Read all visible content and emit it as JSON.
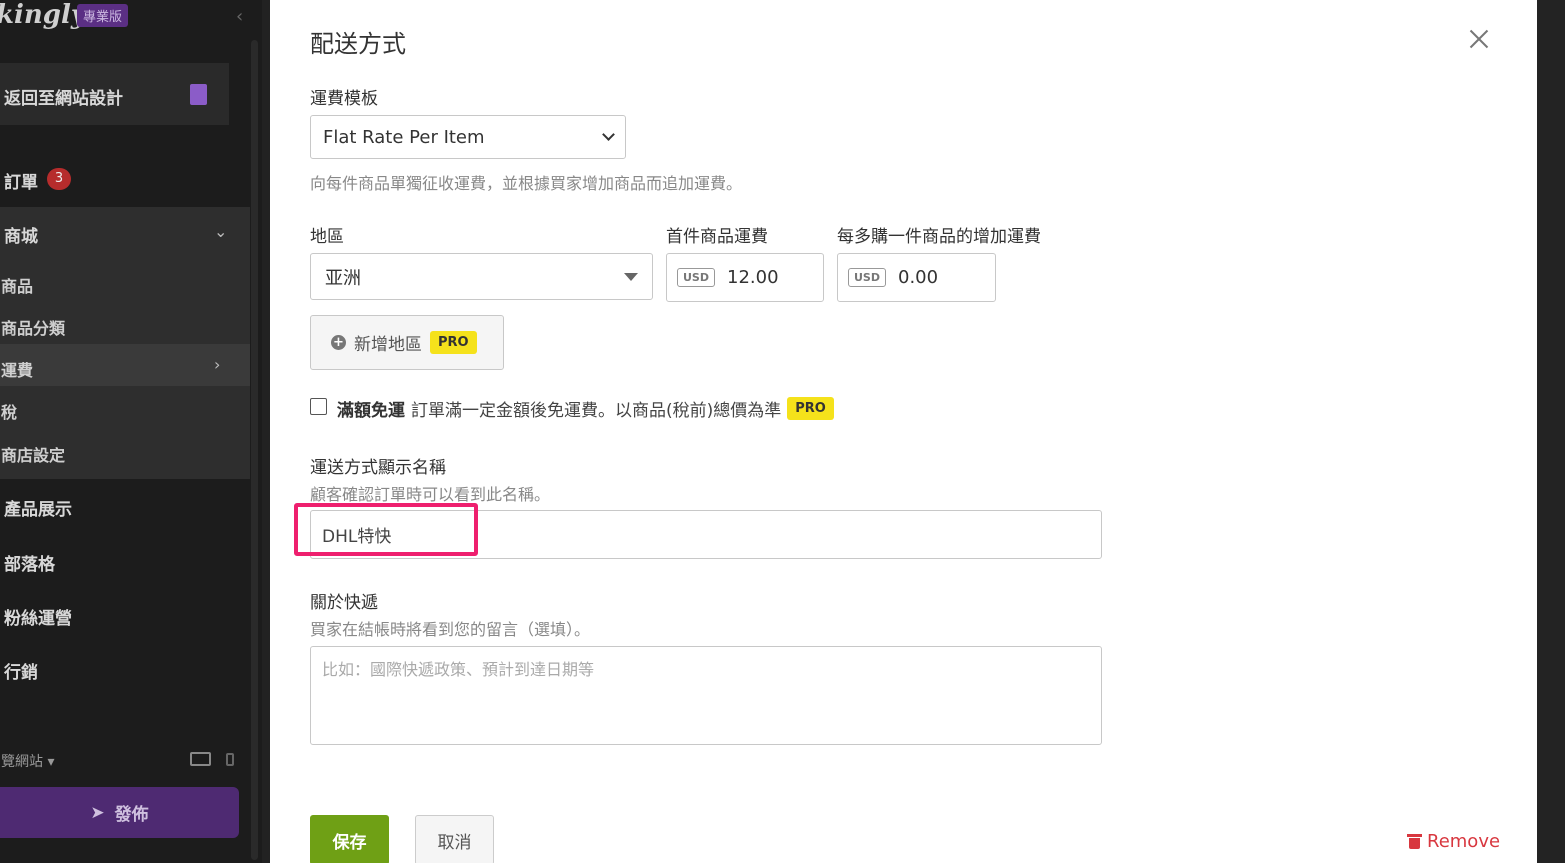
{
  "sidebar": {
    "logo": "kingly",
    "plan_badge": "專業版",
    "back_label": "返回至網站設計",
    "orders_label": "訂單",
    "orders_count": "3",
    "shop_label": "商城",
    "shop_items": [
      "商品",
      "商品分類",
      "運費",
      "稅",
      "商店設定"
    ],
    "products_label": "產品展示",
    "blog_label": "部落格",
    "fans_label": "粉絲運營",
    "marketing_label": "行銷",
    "preview_label": "覽網站",
    "publish_label": "發佈"
  },
  "modal": {
    "title": "配送方式",
    "template_label": "運費模板",
    "template_value": "Flat Rate Per Item",
    "template_help": "向每件商品單獨征收運費，並根據買家增加商品而追加運費。",
    "region_label": "地區",
    "region_value": "亚洲",
    "first_fee_label": "首件商品運費",
    "first_fee_currency": "USD",
    "first_fee_value": "12.00",
    "additional_fee_label": "每多購一件商品的增加運費",
    "additional_fee_currency": "USD",
    "additional_fee_value": "0.00",
    "add_region_label": "新增地區",
    "pro_label": "PRO",
    "free_shipping_title": "滿額免運",
    "free_shipping_desc": "訂單滿一定金額後免運費。以商品(稅前)總價為準",
    "display_name_label": "運送方式顯示名稱",
    "display_name_help": "顧客確認訂單時可以看到此名稱。",
    "display_name_value": "DHL特快",
    "courier_label": "關於快遞",
    "courier_help": "買家在結帳時將看到您的留言（選填）。",
    "courier_placeholder": "比如：國際快遞政策、預計到達日期等",
    "save_label": "保存",
    "cancel_label": "取消",
    "remove_label": "Remove"
  },
  "colors": {
    "primary_green": "#6fa015",
    "highlight_pink": "#ee1f6e",
    "pro_yellow": "#f5e21b",
    "danger_red": "#d8373f"
  }
}
